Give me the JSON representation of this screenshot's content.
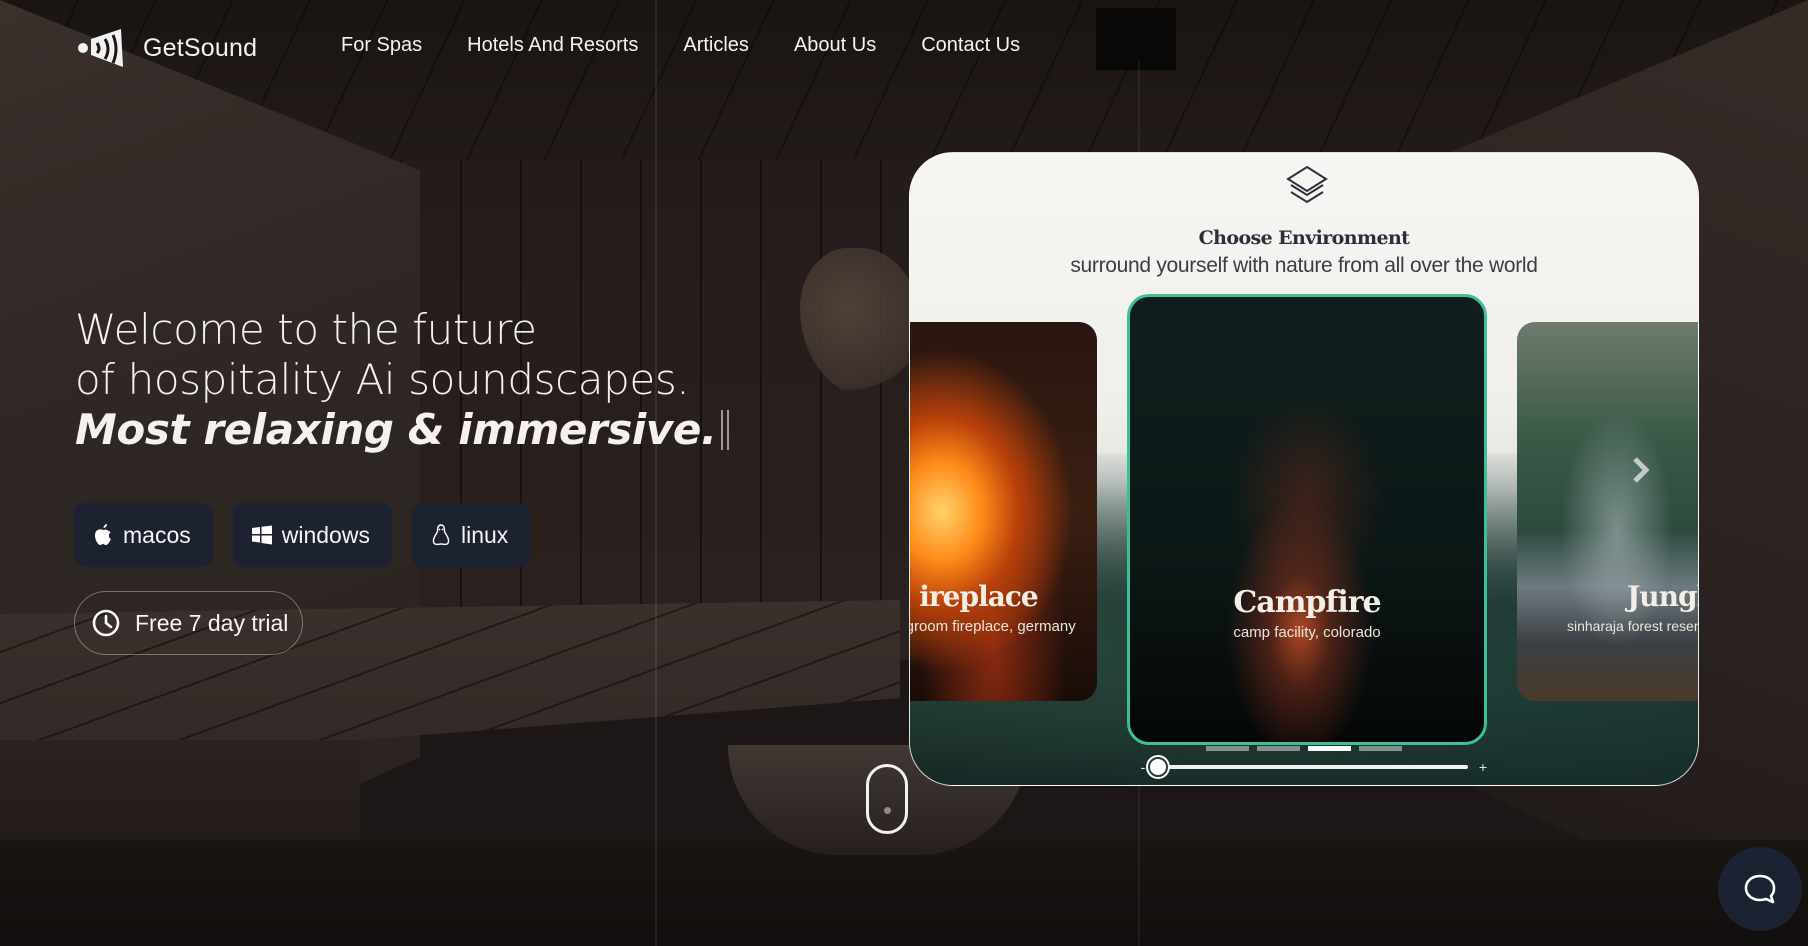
{
  "brand": {
    "name": "GetSound",
    "logo_icon": "sound-wave-fan-icon"
  },
  "nav": {
    "items": [
      {
        "label": "For Spas"
      },
      {
        "label": "Hotels And Resorts"
      },
      {
        "label": "Articles"
      },
      {
        "label": "About Us"
      },
      {
        "label": "Contact Us"
      }
    ]
  },
  "hero": {
    "line1": "Welcome to the future",
    "line2": "of hospitality Ai soundscapes.",
    "line3": "Most relaxing & immersive.",
    "platforms": [
      {
        "label": "macos",
        "icon": "apple-icon"
      },
      {
        "label": "windows",
        "icon": "windows-icon"
      },
      {
        "label": "linux",
        "icon": "linux-tux-icon"
      }
    ],
    "trial": {
      "label": "Free 7 day trial",
      "icon": "clock-icon"
    }
  },
  "environment": {
    "icon": "layers-icon",
    "title": "Choose Environment",
    "subtitle": "surround yourself with nature from all over the world",
    "tiles": [
      {
        "name": "Fireplace",
        "visible_name": "ireplace",
        "location": "livingroom fireplace, germany",
        "visible_location": "ngroom fireplace, germany"
      },
      {
        "name": "Campfire",
        "location": "camp facility, colorado",
        "selected": true
      },
      {
        "name": "Jungle",
        "visible_name": "Jungle",
        "location": "sinharaja forest reserve",
        "visible_location": "sinharaja forest reser"
      }
    ],
    "carousel_pages": 4,
    "carousel_active_index": 2,
    "zoom_slider": {
      "minus_label": "-",
      "plus_label": "+",
      "value_fraction": 0.0
    }
  },
  "colors": {
    "button_bg": "#1c2230",
    "accent_teal": "#3dbf98",
    "chat_bg": "#1b2232"
  }
}
